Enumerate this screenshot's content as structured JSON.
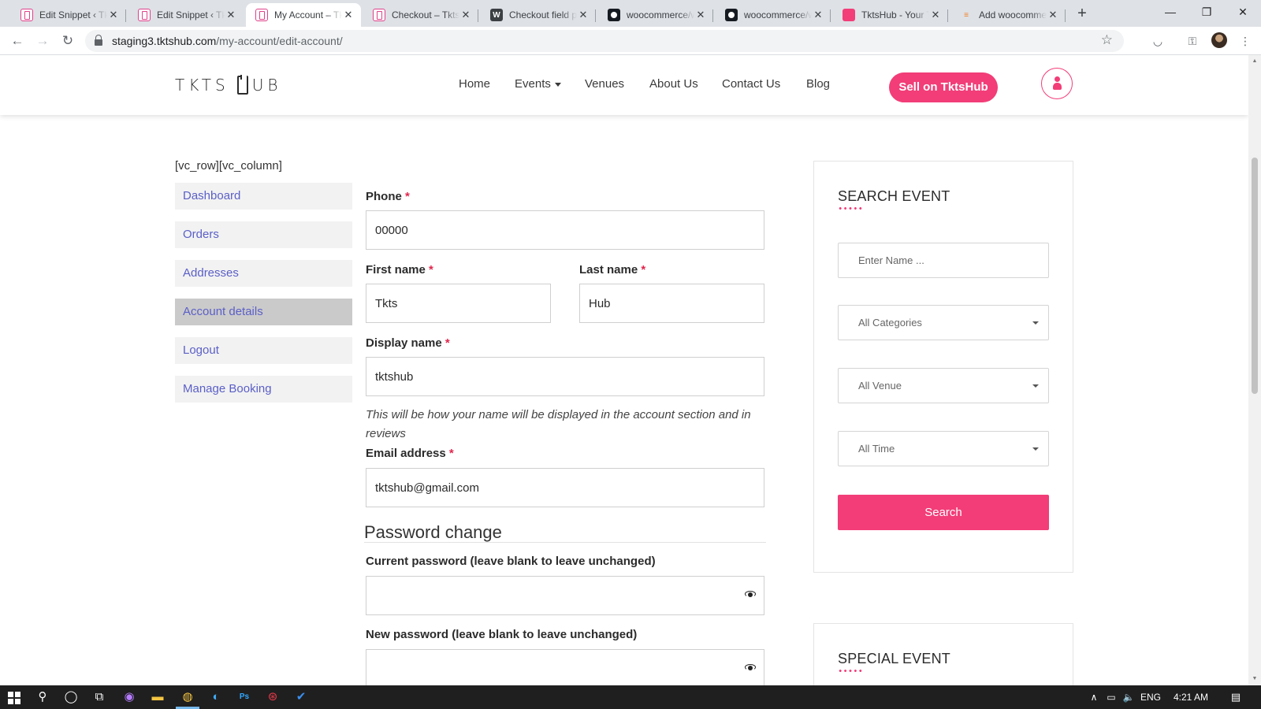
{
  "browser": {
    "tabs": [
      {
        "title": "Edit Snippet ‹ TktsHub",
        "favicon": "tktshub-ticket-icon"
      },
      {
        "title": "Edit Snippet ‹ TktsHub",
        "favicon": "tktshub-ticket-icon"
      },
      {
        "title": "My Account – TktsHub",
        "favicon": "tktshub-ticket-icon",
        "active": true
      },
      {
        "title": "Checkout – TktsHub",
        "favicon": "tktshub-ticket-icon"
      },
      {
        "title": "Checkout field placement",
        "favicon": "wordpress-icon"
      },
      {
        "title": "woocommerce/woocommerce",
        "favicon": "github-icon"
      },
      {
        "title": "woocommerce/woocommerce",
        "favicon": "github-icon"
      },
      {
        "title": "TktsHub - Your Ticket Hub",
        "favicon": "tktshub-app-icon"
      },
      {
        "title": "Add woocommerce field",
        "favicon": "stackoverflow-icon"
      }
    ],
    "new_tab": "+",
    "url_host": "staging3.tktshub.com",
    "url_path": "/my-account/edit-account/"
  },
  "site": {
    "logo_left": "TKTS",
    "logo_right": "UB",
    "nav": [
      "Home",
      "Events",
      "Venues",
      "About Us",
      "Contact Us",
      "Blog"
    ],
    "sell_button": "Sell on TktsHub",
    "accent_color": "#f23d78"
  },
  "page": {
    "shortcode_text": "[vc_row][vc_column]",
    "account_nav": [
      "Dashboard",
      "Orders",
      "Addresses",
      "Account details",
      "Logout",
      "Manage Booking"
    ],
    "account_nav_active": "Account details"
  },
  "form": {
    "phone_label": "Phone",
    "phone_value": "00000",
    "first_name_label": "First name",
    "first_name_value": "Tkts",
    "last_name_label": "Last name",
    "last_name_value": "Hub",
    "display_name_label": "Display name",
    "display_name_value": "tktshub",
    "display_name_hint": "This will be how your name will be displayed in the account section and in reviews",
    "email_label": "Email address",
    "email_value": "tktshub@gmail.com",
    "required_mark": "*",
    "password_section_title": "Password change",
    "current_password_label": "Current password (leave blank to leave unchanged)",
    "new_password_label": "New password (leave blank to leave unchanged)"
  },
  "sidebar": {
    "search_title": "SEARCH EVENT",
    "name_placeholder": "Enter Name ...",
    "category_select": "All Categories",
    "venue_select": "All Venue",
    "time_select": "All Time",
    "search_button": "Search",
    "special_title": "SPECIAL EVENT"
  },
  "taskbar": {
    "language": "ENG",
    "time": "4:21 AM"
  }
}
